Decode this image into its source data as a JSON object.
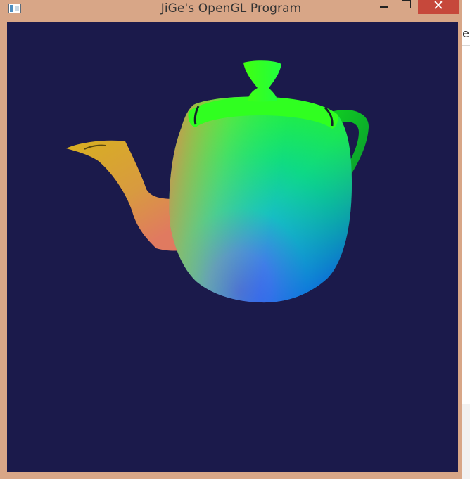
{
  "window": {
    "title": "JiGe's OpenGL Program",
    "close_glyph": "✕",
    "frame_color": "#d8a687",
    "close_color": "#c6483b"
  },
  "canvas": {
    "background": "#1b1a4b",
    "object": "teapot"
  },
  "background_app": {
    "visible_text": "e"
  }
}
